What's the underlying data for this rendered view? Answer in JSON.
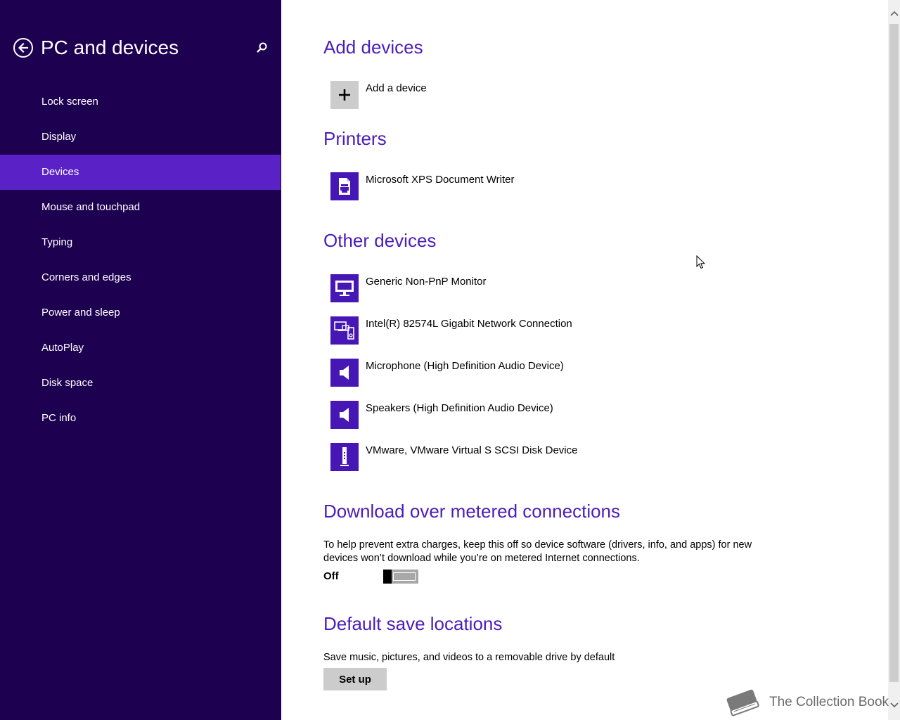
{
  "sidebar": {
    "title": "PC and devices",
    "items": [
      {
        "label": "Lock screen"
      },
      {
        "label": "Display"
      },
      {
        "label": "Devices",
        "selected": true
      },
      {
        "label": "Mouse and touchpad"
      },
      {
        "label": "Typing"
      },
      {
        "label": "Corners and edges"
      },
      {
        "label": "Power and sleep"
      },
      {
        "label": "AutoPlay"
      },
      {
        "label": "Disk space"
      },
      {
        "label": "PC info"
      }
    ]
  },
  "main": {
    "add_devices": {
      "heading": "Add devices",
      "add_label": "Add a device"
    },
    "printers": {
      "heading": "Printers",
      "items": [
        {
          "label": "Microsoft XPS Document Writer",
          "icon": "printer-icon"
        }
      ]
    },
    "other_devices": {
      "heading": "Other devices",
      "items": [
        {
          "label": "Generic Non-PnP Monitor",
          "icon": "monitor-icon"
        },
        {
          "label": "Intel(R) 82574L Gigabit Network Connection",
          "icon": "network-devices-icon"
        },
        {
          "label": "Microphone (High Definition Audio Device)",
          "icon": "speaker-icon"
        },
        {
          "label": "Speakers (High Definition Audio Device)",
          "icon": "speaker-icon"
        },
        {
          "label": "VMware, VMware Virtual S SCSI Disk Device",
          "icon": "drive-icon"
        }
      ]
    },
    "metered": {
      "heading": "Download over metered connections",
      "description": "To help prevent extra charges, keep this off so device software (drivers, info, and apps) for new devices won’t download while you’re on metered Internet connections.",
      "toggle_state": "Off",
      "toggle_on": false
    },
    "save_locations": {
      "heading": "Default save locations",
      "description": "Save music, pictures, and videos to a removable drive by default",
      "button_label": "Set up"
    }
  },
  "watermark": {
    "text": "The Collection Book"
  },
  "colors": {
    "sidebar_bg": "#1e0051",
    "selected_bg": "#5a22c6",
    "accent": "#4b1dbb",
    "tile": "#4617b4"
  }
}
